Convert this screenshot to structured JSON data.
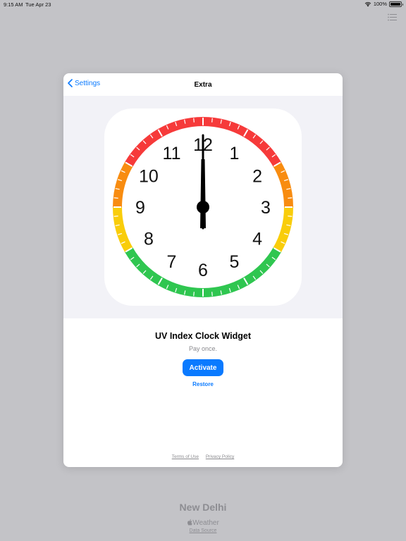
{
  "status_bar": {
    "time": "9:15 AM",
    "date": "Tue Apr 23",
    "battery": "100%"
  },
  "nav": {
    "back_label": "Settings",
    "title": "Extra"
  },
  "clock": {
    "numerals": [
      "12",
      "1",
      "2",
      "3",
      "4",
      "5",
      "6",
      "7",
      "8",
      "9",
      "10",
      "11"
    ],
    "zone_colors": {
      "red": "#f63a3a",
      "orange": "#f88c10",
      "yellow": "#f9cd0a",
      "green": "#2fc650"
    }
  },
  "product": {
    "title": "UV Index Clock Widget",
    "subtitle": "Pay once.",
    "activate_label": "Activate",
    "restore_label": "Restore"
  },
  "footer": {
    "terms": "Terms of Use",
    "privacy": "Privacy Policy"
  },
  "background": {
    "city": "New Delhi",
    "weather_brand": "Weather",
    "data_source": "Data Source"
  },
  "colors": {
    "accent": "#0a7aff",
    "backdrop": "#c3c3c7"
  }
}
